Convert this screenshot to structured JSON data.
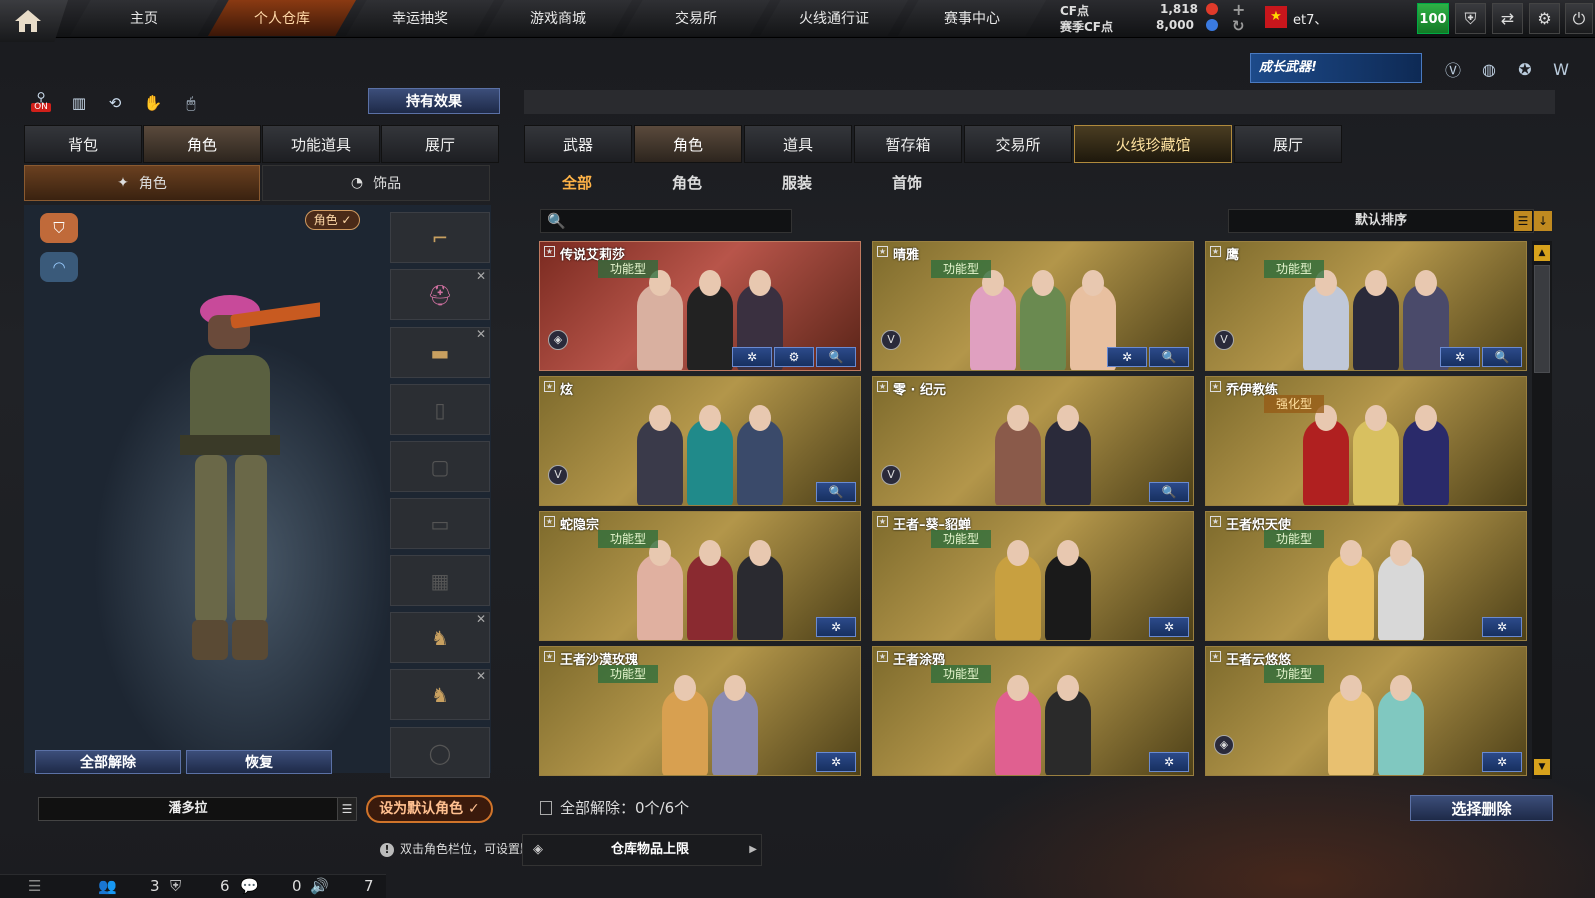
{
  "nav": {
    "home_icon": "home-icon",
    "items": [
      "主页",
      "个人仓库",
      "幸运抽奖",
      "游戏商城",
      "交易所",
      "火线通行证",
      "赛事中心"
    ],
    "active_index": 1
  },
  "currency": {
    "cf_label": "CF点",
    "cf_value": "1,818",
    "season_label": "赛季CF点",
    "season_value": "8,000",
    "add_icon": "+",
    "refresh_icon": "↻"
  },
  "user": {
    "flag_icon": "★",
    "name": "et7、",
    "level": "100"
  },
  "toolbar_icons": [
    "shield-icon",
    "share-icon",
    "gear-icon",
    "power-icon"
  ],
  "banner": {
    "text": "成长武器!"
  },
  "left": {
    "tool_on_label": "ON",
    "effects_button": "持有效果",
    "tabs": [
      "背包",
      "角色",
      "功能道具",
      "展厅"
    ],
    "active_tab": 1,
    "subtabs": [
      "角色",
      "饰品"
    ],
    "role_badge": "角色 ✓",
    "release_all": "全部解除",
    "restore": "恢复",
    "character_name": "潘多拉",
    "set_default": "设为默认角色 ✓",
    "hint": "双击角色栏位，可设置默认角色。",
    "storage_label": "仓库物品上限"
  },
  "status": {
    "friends": "3",
    "clan": "6",
    "chat": "0",
    "voice": "7"
  },
  "right": {
    "tabs": [
      "武器",
      "角色",
      "道具",
      "暂存箱",
      "交易所",
      "火线珍藏馆",
      "展厅"
    ],
    "active_tab": 1,
    "special_tab": 5,
    "filters": [
      "全部",
      "角色",
      "服装",
      "首饰"
    ],
    "active_filter": 0,
    "sort_label": "默认排序",
    "footer": "全部解除：0个/6个",
    "select_delete": "选择删除"
  },
  "cards": [
    {
      "name": "传说艾莉莎",
      "type": "功能型",
      "mark": "◈",
      "actions": [
        "✲",
        "⚙",
        "🔍"
      ],
      "red": true
    },
    {
      "name": "晴雅",
      "type": "功能型",
      "mark": "V",
      "actions": [
        "✲",
        "🔍"
      ],
      "red": false
    },
    {
      "name": "鹰",
      "type": "功能型",
      "mark": "V",
      "actions": [
        "✲",
        "🔍"
      ],
      "red": false
    },
    {
      "name": "炫",
      "type": "",
      "mark": "V",
      "actions": [
        "🔍"
      ],
      "red": false
    },
    {
      "name": "零 · 纪元",
      "type": "",
      "mark": "V",
      "actions": [
        "🔍"
      ],
      "red": false
    },
    {
      "name": "乔伊教练",
      "type": "强化型",
      "mark": "",
      "actions": [],
      "red": false
    },
    {
      "name": "蛇隐宗",
      "type": "功能型",
      "mark": "",
      "actions": [
        "✲"
      ],
      "red": false
    },
    {
      "name": "王者–葵–貂蝉",
      "type": "功能型",
      "mark": "",
      "actions": [
        "✲"
      ],
      "red": false
    },
    {
      "name": "王者炽天使",
      "type": "功能型",
      "mark": "",
      "actions": [
        "✲"
      ],
      "red": false
    },
    {
      "name": "王者沙漠玫瑰",
      "type": "功能型",
      "mark": "",
      "actions": [
        "✲"
      ],
      "red": false
    },
    {
      "name": "王者涂鸦",
      "type": "功能型",
      "mark": "",
      "actions": [
        "✲"
      ],
      "red": false
    },
    {
      "name": "王者云悠悠",
      "type": "功能型",
      "mark": "◈",
      "actions": [
        "✲"
      ],
      "red": false
    }
  ]
}
